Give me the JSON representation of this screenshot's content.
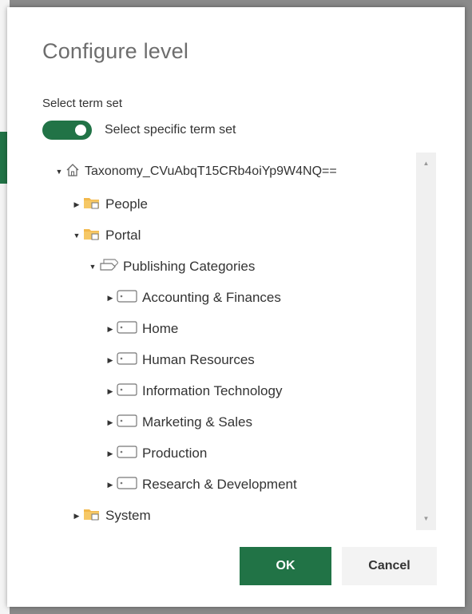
{
  "dialog": {
    "title": "Configure level",
    "section_label": "Select term set",
    "toggle_label": "Select specific term set",
    "toggle_on": true,
    "accent_color": "#217346"
  },
  "tree": {
    "root": {
      "label": "Taxonomy_CVuAbqT15CRb4oiYp9W4NQ==",
      "icon": "home-icon",
      "expanded": true
    },
    "groups": [
      {
        "label": "People",
        "icon": "folder-icon",
        "expanded": false
      },
      {
        "label": "Portal",
        "icon": "folder-icon",
        "expanded": true
      },
      {
        "label": "System",
        "icon": "folder-icon",
        "expanded": false
      }
    ],
    "term_set": {
      "label": "Publishing Categories",
      "icon": "term-set-icon",
      "expanded": true
    },
    "terms": [
      {
        "label": "Accounting & Finances",
        "icon": "tag-icon"
      },
      {
        "label": "Home",
        "icon": "tag-icon"
      },
      {
        "label": "Human Resources",
        "icon": "tag-icon"
      },
      {
        "label": "Information Technology",
        "icon": "tag-icon"
      },
      {
        "label": "Marketing & Sales",
        "icon": "tag-icon"
      },
      {
        "label": "Production",
        "icon": "tag-icon"
      },
      {
        "label": "Research & Development",
        "icon": "tag-icon"
      }
    ]
  },
  "buttons": {
    "ok": "OK",
    "cancel": "Cancel"
  }
}
